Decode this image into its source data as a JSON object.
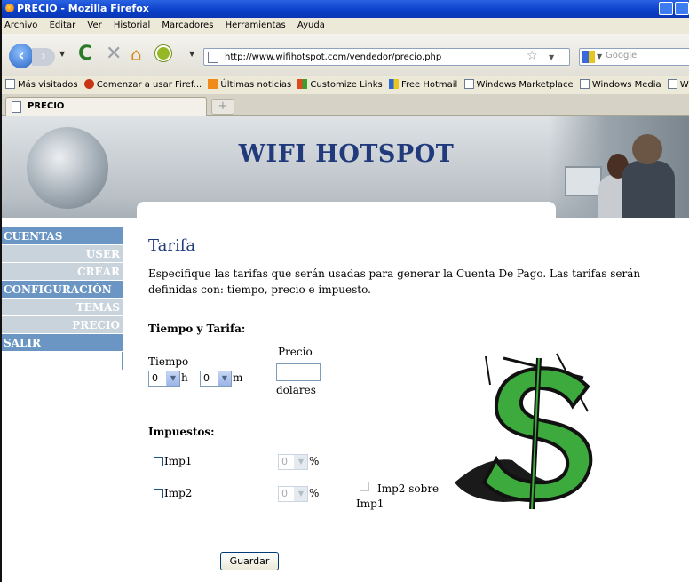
{
  "browser": {
    "window_title": "PRECIO - Mozilla Firefox",
    "menu": [
      "Archivo",
      "Editar",
      "Ver",
      "Historial",
      "Marcadores",
      "Herramientas",
      "Ayuda"
    ],
    "url": "http://www.wifihotspot.com/vendedor/precio.php",
    "search_placeholder": "Google",
    "bookmarks": [
      "Más visitados",
      "Comenzar a usar Firef...",
      "Últimas noticias",
      "Customize Links",
      "Free Hotmail",
      "Windows Marketplace",
      "Windows Media",
      "Windows"
    ],
    "tab_title": "PRECIO",
    "new_tab": "+"
  },
  "site": {
    "title": "WIFI HOTSPOT"
  },
  "sidebar": {
    "items": [
      {
        "label": "CUENTAS",
        "kind": "main"
      },
      {
        "label": "USER",
        "kind": "sub"
      },
      {
        "label": "CREAR",
        "kind": "sub"
      },
      {
        "label": "CONFIGURACIÓN",
        "kind": "main"
      },
      {
        "label": "TEMAS",
        "kind": "sub"
      },
      {
        "label": "PRECIO",
        "kind": "sub"
      },
      {
        "label": "SALIR",
        "kind": "main"
      }
    ]
  },
  "content": {
    "title": "Tarifa",
    "description": "Especifique las tarifas que serán usadas para generar la Cuenta De Pago. Las tarifas serán definidas con: tiempo, precio e impuesto.",
    "section_time": "Tiempo y Tarifa:",
    "tiempo_label": "Tiempo",
    "hours_value": "0",
    "hours_unit": "h",
    "minutes_value": "0",
    "minutes_unit": "m",
    "precio_label": "Precio",
    "precio_value": "",
    "currency_label": "dolares",
    "section_tax": "Impuestos:",
    "imp1_label": "Imp1",
    "imp1_value": "0",
    "imp1_unit": "%",
    "imp2_label": "Imp2",
    "imp2_value": "0",
    "imp2_unit": "%",
    "imp2_sobre_label": "Imp2 sobre Imp1",
    "save_label": "Guardar"
  },
  "colors": {
    "titlebar": "#0a3fc8",
    "site_title": "#213a7c",
    "sidebar_main": "#6b96c4",
    "sidebar_sub": "#c8d3dc",
    "dollar_green": "#3caa3c"
  }
}
